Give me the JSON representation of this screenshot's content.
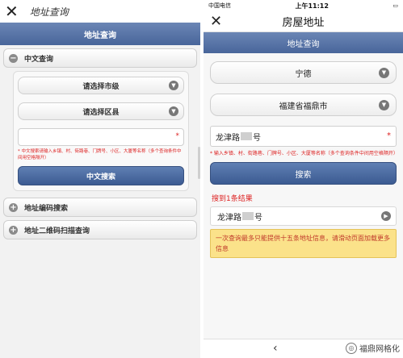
{
  "left": {
    "app_title": "地址查询",
    "header": "地址查询",
    "section_chinese": "中文查询",
    "select_city": "请选择市级",
    "select_district": "请选择区县",
    "input_star": "*",
    "hint": "* 中文搜索请输入乡镇、村、街路巷、门牌号、小区、大厦等名称（多个查询条件中间用空格隔开）",
    "search_button": "中文搜索",
    "section_code": "地址编码搜索",
    "section_qr": "地址二维码扫描查询"
  },
  "right": {
    "status": {
      "carrier": "中国电信",
      "time": "上午11:12",
      "battery": "▭"
    },
    "title": "房屋地址",
    "header": "地址查询",
    "select_city": "宁德",
    "select_district": "福建省福鼎市",
    "input_value_a": "龙津路",
    "input_value_b": "号",
    "input_star": "*",
    "hint": "* 输入乡镇、村、街路巷、门牌号、小区、大厦等名称（多个查询条件中间用空格隔开）",
    "search_button": "搜索",
    "result_title": "搜到1条结果",
    "result_a": "龙津路",
    "result_b": "号",
    "notice": "一次查询最多只能提供十五条地址信息，请滑动页面加载更多信息",
    "watermark": "福鼎网格化"
  }
}
